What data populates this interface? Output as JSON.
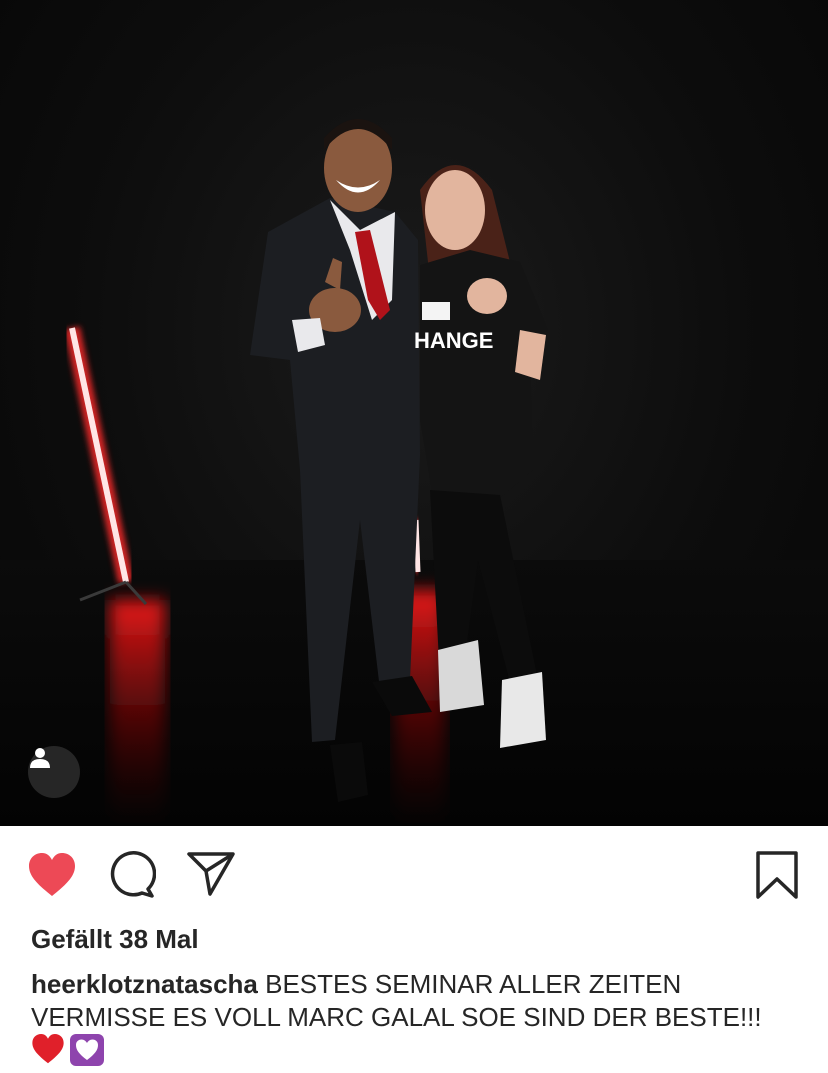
{
  "post": {
    "likes_text": "Gefällt 38 Mal",
    "username": "heerklotznatascha",
    "caption": "BESTES SEMINAR ALLER ZEITEN VERMISSE ES VOLL MARC GALAL SOE SIND DER BESTE!!!",
    "caption_emojis": [
      "red-heart",
      "purple-heart"
    ],
    "shirt_text": "HANGE",
    "liked": true
  },
  "icons": {
    "like": "heart-icon",
    "comment": "comment-icon",
    "share": "send-icon",
    "save": "bookmark-icon",
    "tag": "user-tag-icon"
  },
  "colors": {
    "like_red": "#ed4956",
    "text": "#262626",
    "neon_red": "#ff2a2a",
    "emoji_purple": "#8e44ad"
  }
}
